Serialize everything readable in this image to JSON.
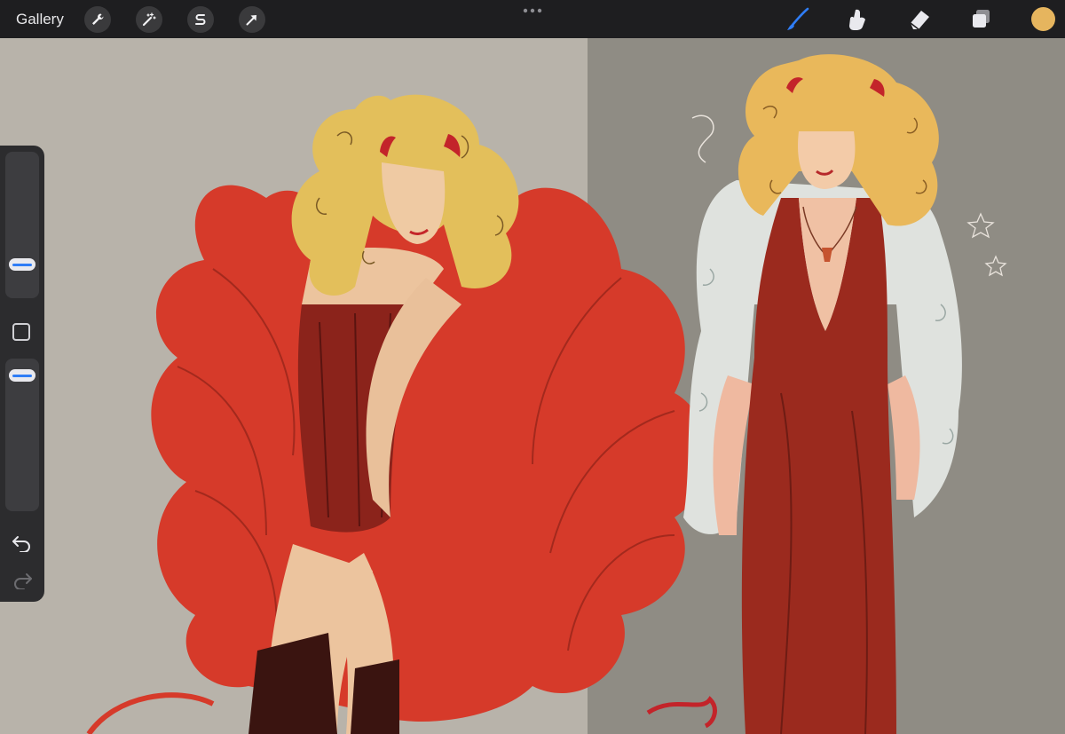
{
  "topbar": {
    "gallery_label": "Gallery",
    "left_tools": [
      "wrench-icon",
      "magic-wand-icon",
      "selection-s-icon",
      "transform-arrow-icon"
    ],
    "right_tools": [
      "brush-icon",
      "smudge-icon",
      "eraser-icon",
      "layers-icon"
    ],
    "active_tool": "brush-icon",
    "accent_color": "#2f7df6",
    "current_color": "#e6b55e"
  },
  "sidebar": {
    "brush_size_level": 0.3,
    "opacity_level": 0.95,
    "controls": [
      "brush-size-slider",
      "modify-square-button",
      "opacity-slider",
      "undo-icon",
      "redo-icon"
    ]
  },
  "canvas": {
    "left_background": "#b8b3aa",
    "right_background": "#8e8b82"
  }
}
